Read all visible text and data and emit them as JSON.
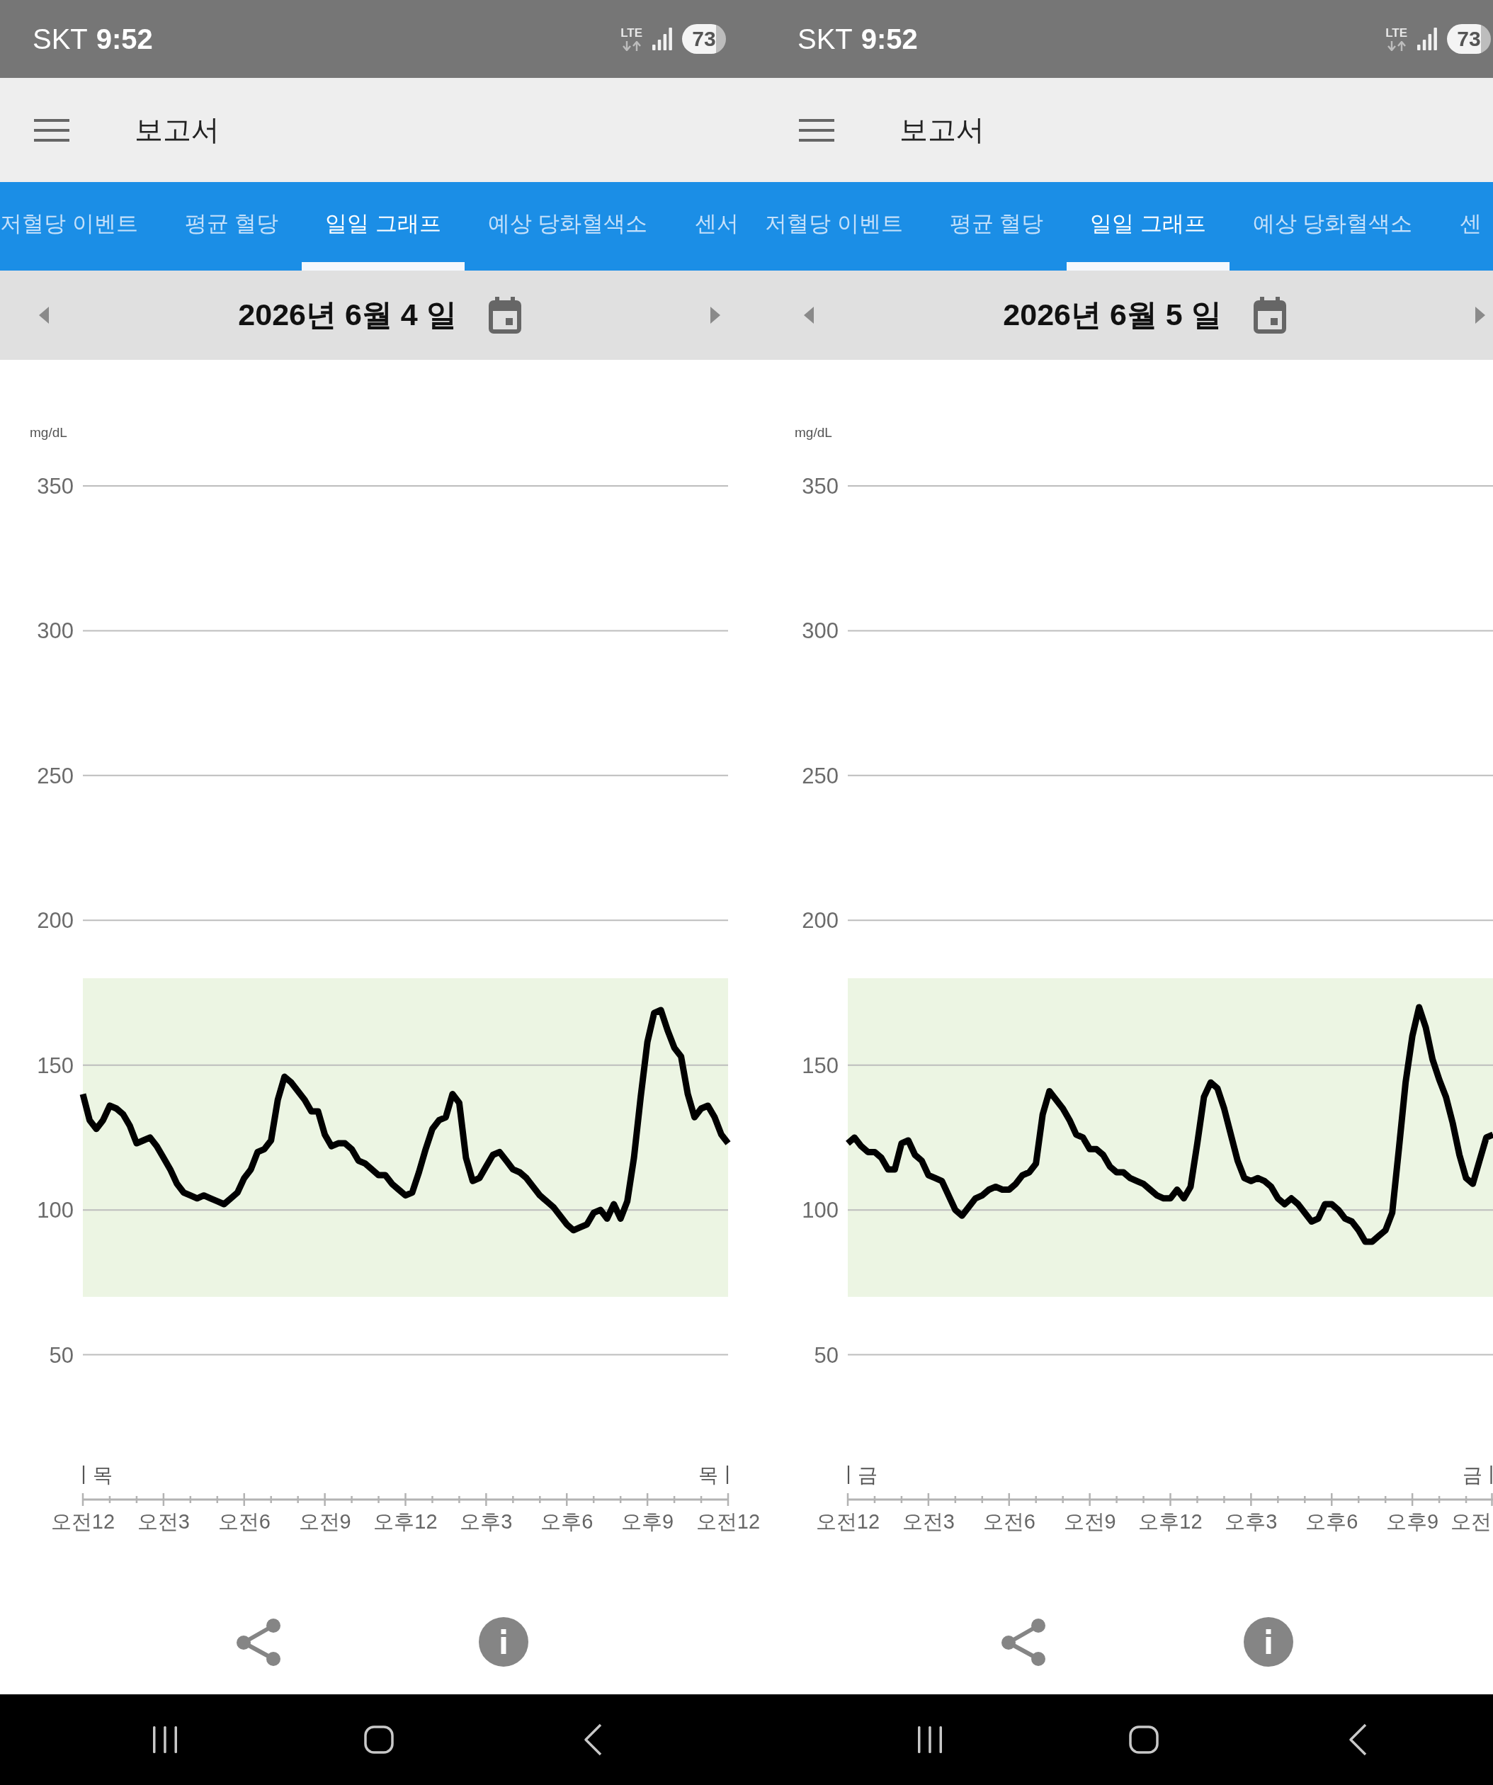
{
  "screens": [
    {
      "status_bar": {
        "carrier": "SKT",
        "time": "9:52",
        "network": "LTE",
        "battery": "73"
      },
      "app_bar": {
        "title": "보고서"
      },
      "tabs": [
        {
          "label": "저혈당 이벤트",
          "selected": false
        },
        {
          "label": "평균 혈당",
          "selected": false
        },
        {
          "label": "일일 그래프",
          "selected": true
        },
        {
          "label": "예상 당화혈색소",
          "selected": false
        },
        {
          "label": "센서",
          "selected": false
        }
      ],
      "date_nav": {
        "date": "2026년 6월 4 일"
      },
      "chart": {
        "chart_data": {
          "type": "line",
          "ylabel": "mg/dL",
          "grid": true,
          "ylim": [
            0,
            350
          ],
          "yticks": [
            50,
            100,
            150,
            200,
            250,
            300,
            350
          ],
          "bands": [
            {
              "axis": "y",
              "from": 70,
              "to": 180
            }
          ],
          "annotations": [
            "목",
            "목"
          ],
          "categories": [
            "오전12",
            null,
            null,
            null,
            null,
            null,
            null,
            null,
            null,
            null,
            null,
            null,
            "오전3",
            null,
            null,
            null,
            null,
            null,
            null,
            null,
            null,
            null,
            null,
            null,
            "오전6",
            null,
            null,
            null,
            null,
            null,
            null,
            null,
            null,
            null,
            null,
            null,
            "오전9",
            null,
            null,
            null,
            null,
            null,
            null,
            null,
            null,
            null,
            null,
            null,
            "오후12",
            null,
            null,
            null,
            null,
            null,
            null,
            null,
            null,
            null,
            null,
            null,
            "오후3",
            null,
            null,
            null,
            null,
            null,
            null,
            null,
            null,
            null,
            null,
            null,
            "오후6",
            null,
            null,
            null,
            null,
            null,
            null,
            null,
            null,
            null,
            null,
            null,
            "오후9",
            null,
            null,
            null,
            null,
            null,
            null,
            null,
            null,
            null,
            null,
            null,
            "오전12"
          ],
          "values": [
            140,
            131,
            128,
            131,
            136,
            135,
            133,
            129,
            123,
            124,
            125,
            122,
            118,
            114,
            109,
            106,
            105,
            104,
            105,
            104,
            103,
            102,
            104,
            106,
            111,
            114,
            120,
            121,
            124,
            138,
            146,
            144,
            141,
            138,
            134,
            134,
            126,
            122,
            123,
            123,
            121,
            117,
            116,
            114,
            112,
            112,
            109,
            107,
            105,
            106,
            113,
            121,
            128,
            131,
            132,
            140,
            137,
            118,
            110,
            111,
            115,
            119,
            120,
            117,
            114,
            113,
            111,
            108,
            105,
            103,
            101,
            98,
            95,
            93,
            94,
            95,
            99,
            100,
            97,
            102,
            97,
            103,
            118,
            139,
            158,
            168,
            169,
            162,
            156,
            153,
            140,
            132,
            135,
            136,
            132,
            126,
            123
          ]
        }
      }
    },
    {
      "status_bar": {
        "carrier": "SKT",
        "time": "9:52",
        "network": "LTE",
        "battery": "73"
      },
      "app_bar": {
        "title": "보고서"
      },
      "tabs": [
        {
          "label": "저혈당 이벤트",
          "selected": false
        },
        {
          "label": "평균 혈당",
          "selected": false
        },
        {
          "label": "일일 그래프",
          "selected": true
        },
        {
          "label": "예상 당화혈색소",
          "selected": false
        },
        {
          "label": "센",
          "selected": false
        }
      ],
      "date_nav": {
        "date": "2026년 6월 5 일"
      },
      "chart": {
        "clipped_tick_label": "오전",
        "chart_data": {
          "type": "line",
          "ylabel": "mg/dL",
          "grid": true,
          "ylim": [
            0,
            350
          ],
          "yticks": [
            50,
            100,
            150,
            200,
            250,
            300,
            350
          ],
          "bands": [
            {
              "axis": "y",
              "from": 70,
              "to": 180
            }
          ],
          "annotations": [
            "금",
            "금"
          ],
          "categories": [
            "오전12",
            null,
            null,
            null,
            null,
            null,
            null,
            null,
            null,
            null,
            null,
            null,
            "오전3",
            null,
            null,
            null,
            null,
            null,
            null,
            null,
            null,
            null,
            null,
            null,
            "오전6",
            null,
            null,
            null,
            null,
            null,
            null,
            null,
            null,
            null,
            null,
            null,
            "오전9",
            null,
            null,
            null,
            null,
            null,
            null,
            null,
            null,
            null,
            null,
            null,
            "오후12",
            null,
            null,
            null,
            null,
            null,
            null,
            null,
            null,
            null,
            null,
            null,
            "오후3",
            null,
            null,
            null,
            null,
            null,
            null,
            null,
            null,
            null,
            null,
            null,
            "오후6",
            null,
            null,
            null,
            null,
            null,
            null,
            null,
            null,
            null,
            null,
            null,
            "오후9",
            null,
            null,
            null,
            null,
            null,
            null,
            null,
            null,
            null,
            null,
            null,
            null
          ],
          "values": [
            123,
            125,
            122,
            120,
            120,
            118,
            114,
            114,
            123,
            124,
            119,
            117,
            112,
            111,
            110,
            105,
            100,
            98,
            101,
            104,
            105,
            107,
            108,
            107,
            107,
            109,
            112,
            113,
            116,
            133,
            141,
            138,
            135,
            131,
            126,
            125,
            121,
            121,
            119,
            115,
            113,
            113,
            111,
            110,
            109,
            107,
            105,
            104,
            104,
            107,
            104,
            108,
            123,
            139,
            144,
            142,
            135,
            126,
            117,
            111,
            110,
            111,
            110,
            108,
            104,
            102,
            104,
            102,
            99,
            96,
            97,
            102,
            102,
            100,
            97,
            96,
            93,
            89,
            89,
            91,
            93,
            99,
            121,
            144,
            160,
            170,
            163,
            152,
            145,
            139,
            130,
            119,
            111,
            109,
            117,
            125,
            126
          ]
        }
      }
    }
  ]
}
